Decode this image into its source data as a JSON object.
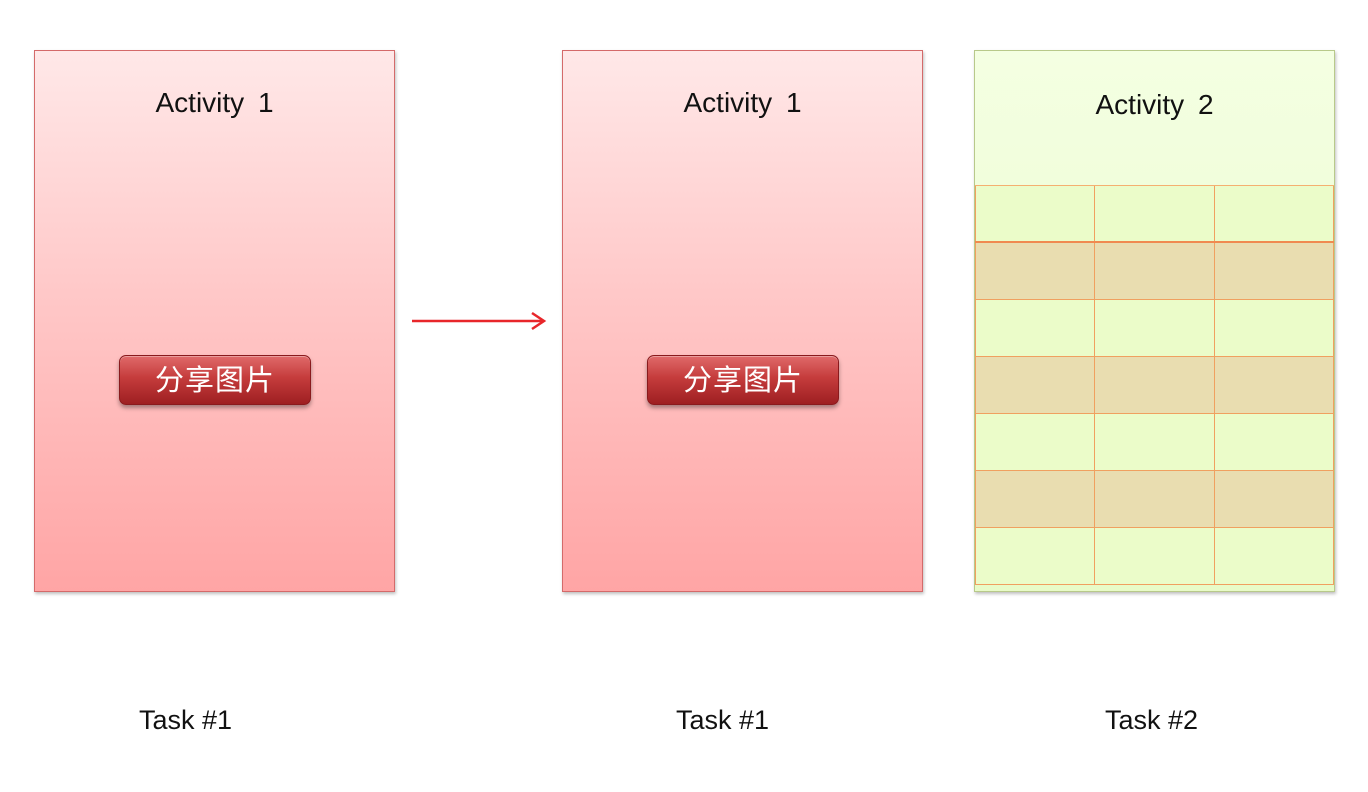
{
  "panels": [
    {
      "title": "Activity  1",
      "button_label": "分享图片",
      "task_label": "Task #1",
      "color": "#ffc0c0"
    },
    {
      "title": "Activity  1",
      "button_label": "分享图片",
      "task_label": "Task #1",
      "color": "#ffc0c0"
    },
    {
      "title": "Activity  2",
      "task_label": "Task #2",
      "color": "#e9fcc8",
      "grid": {
        "rows": 7,
        "columns": 3
      }
    }
  ],
  "arrow": {
    "color": "#e8262a",
    "from": "panel-1",
    "to": "panel-2"
  },
  "colors": {
    "button": "#b52e30",
    "grid_line": "#f0a060",
    "grid_alt_row": "#e9ddb0"
  }
}
